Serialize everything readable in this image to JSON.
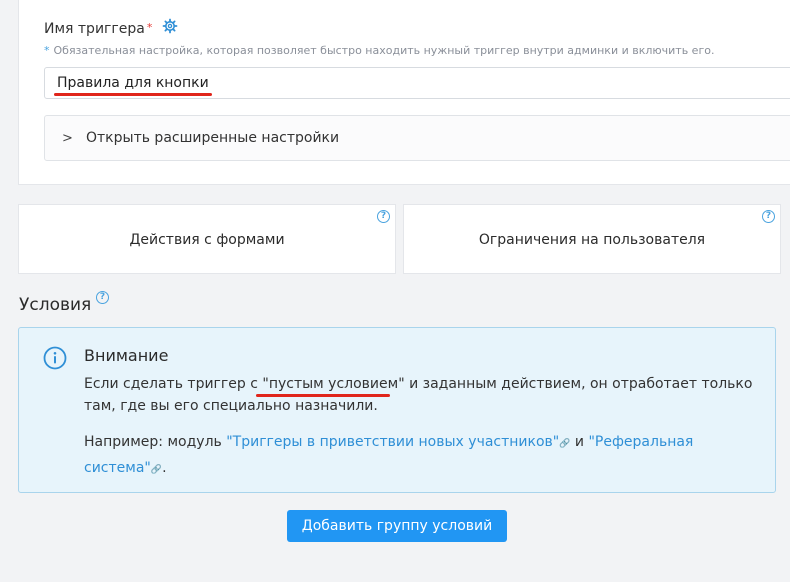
{
  "trigger_field": {
    "label": "Имя триггера",
    "required_mark": "*",
    "hint": "Обязательная настройка, которая позволяет быстро находить нужный триггер внутри админки и включить его.",
    "hint_bullet": "*",
    "value": "Правила для кнопки"
  },
  "advanced": {
    "label": "Открыть расширенные настройки",
    "chevron": ">"
  },
  "tiles": [
    {
      "label": "Действия с формами",
      "help": "?"
    },
    {
      "label": "Ограничения на пользователя",
      "help": "?"
    }
  ],
  "conditions": {
    "title": "Условия",
    "help": "?"
  },
  "alert": {
    "title": "Внимание",
    "p1_before": "Если сделать триггер с ",
    "p1_quoted": "\"пустым условием\"",
    "p1_after": " и заданным действием, он отработает только там, где вы его специально назначили.",
    "p2_before": "Например: модуль ",
    "link1": "\"Триггеры в приветствии новых участников\"",
    "p2_mid": " и ",
    "link2": "\"Реферальная система\"",
    "p2_end": "."
  },
  "add_group_button": "Добавить группу условий",
  "colors": {
    "accent": "#2196f3",
    "link": "#2f8fd6",
    "alert_bg": "#e7f4fb",
    "alert_border": "#a9d4ec",
    "annotation": "#e0251b"
  }
}
